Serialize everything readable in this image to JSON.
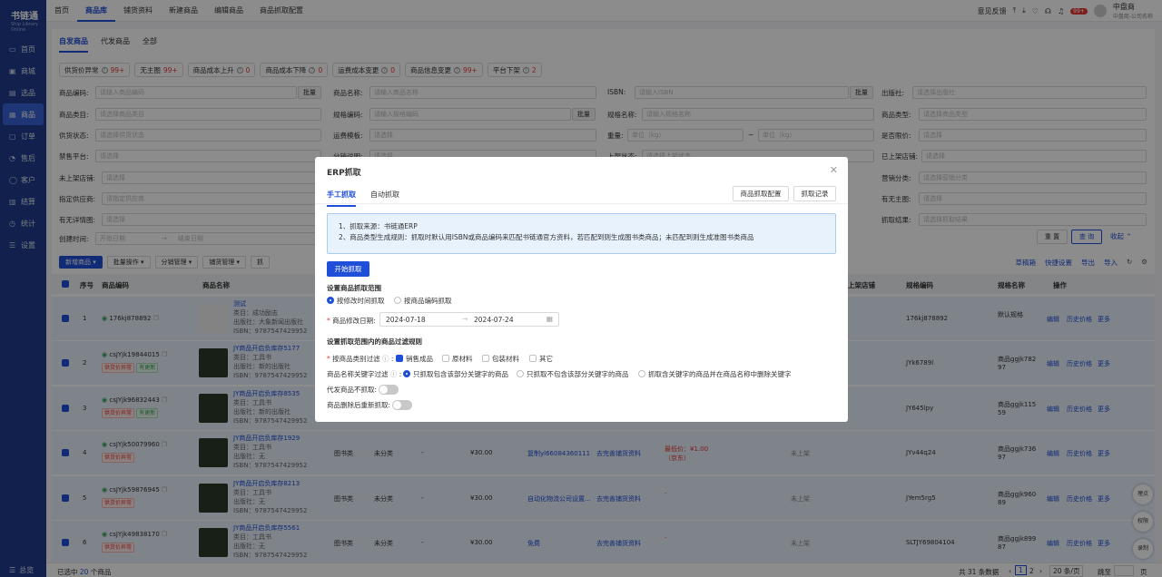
{
  "app": {
    "name": "书链通",
    "subtitle": "Ship Library Online"
  },
  "sidebar": {
    "items": [
      {
        "label": "首页",
        "icon": "monitor-icon"
      },
      {
        "label": "商城",
        "icon": "shop-icon"
      },
      {
        "label": "选品",
        "icon": "select-icon"
      },
      {
        "label": "商品",
        "icon": "product-icon"
      },
      {
        "label": "订单",
        "icon": "order-icon"
      },
      {
        "label": "售后",
        "icon": "aftersale-icon"
      },
      {
        "label": "客户",
        "icon": "customer-icon"
      },
      {
        "label": "结算",
        "icon": "settle-icon"
      },
      {
        "label": "统计",
        "icon": "stats-icon"
      },
      {
        "label": "设置",
        "icon": "settings-icon"
      }
    ],
    "bottom": "总览"
  },
  "topnav": {
    "tabs": [
      "首页",
      "商品库",
      "铺货资料",
      "新建商品",
      "编辑商品",
      "商品抓取配置"
    ],
    "feedback": "意见反馈",
    "badge": "99+",
    "user_name": "中盘商",
    "user_role": "中盘商-公司名称"
  },
  "subtabs": [
    "自发商品",
    "代发商品",
    "全部"
  ],
  "filter_chips": [
    {
      "label": "供货价异常",
      "count": "99+"
    },
    {
      "label": "无主图",
      "count": "99+"
    },
    {
      "label": "商品成本上升",
      "count": "0"
    },
    {
      "label": "商品成本下降",
      "count": "0"
    },
    {
      "label": "运费成本变更",
      "count": "0"
    },
    {
      "label": "商品信息变更",
      "count": "99+"
    },
    {
      "label": "平台下架",
      "count": "2"
    }
  ],
  "form": {
    "product_code": "商品编码:",
    "product_code_ph": "请输入商品编码",
    "batch": "批量",
    "product_name": "商品名称:",
    "product_name_ph": "请输入商品名称",
    "isbn": "ISBN:",
    "isbn_ph": "请输入ISBN",
    "publisher": "出版社:",
    "publisher_ph": "请选择出版社",
    "category": "商品类目:",
    "category_ph": "请选择商品类目",
    "spec_code": "规格编码:",
    "spec_code_ph": "请输入规格编码",
    "spec_name": "规格名称:",
    "spec_name_ph": "请输入规格名称",
    "product_type": "商品类型:",
    "product_type_ph": "请选择商品类型",
    "supply_status": "供货状态:",
    "supply_status_ph": "请选择供货状态",
    "freight_tpl": "运费模板:",
    "freight_tpl_ph": "请选择",
    "weight": "重量:",
    "weight_ph": "单位（kg）",
    "weight_to": "~",
    "limit_price": "是否限价:",
    "limit_price_ph": "请选择",
    "banned_platform": "禁售平台:",
    "banned_platform_ph": "请选择",
    "dist_note": "分销说明:",
    "dist_note_ph": "请选择",
    "shelf_status": "上架状态:",
    "shelf_status_ph": "请选择上架状态",
    "listed_store": "已上架店铺:",
    "listed_store_ph": "请选择",
    "unlisted_store": "未上架店铺:",
    "unlisted_store_ph": "请选择",
    "marketing": "营销分类:",
    "marketing_ph": "请选择营销分类",
    "supplier": "指定供应商:",
    "supplier_ph": "请指定供应商",
    "no_main_img": "有无主图:",
    "no_main_img_ph": "请选择",
    "detail_img": "有无详情图:",
    "detail_img_ph": "请选择",
    "grab_result": "抓取结果:",
    "grab_result_ph": "请选择抓取结果",
    "created": "创建时间:",
    "start_date_ph": "开始日期",
    "end_date_ph": "结束日期",
    "reset": "重 置",
    "search": "查 询",
    "collapse": "收起"
  },
  "toolbar": {
    "new_product": "新增商品",
    "batch_ops": "批量操作",
    "dist_mgmt": "分销管理",
    "stock_mgmt": "铺货管理",
    "more": "抓",
    "draft": "草稿箱",
    "quick_settings": "快捷设置",
    "export": "导出",
    "import": "导入"
  },
  "table": {
    "headers": [
      "序号",
      "商品编码",
      "商品名称",
      "上架店铺",
      "规格编码",
      "规格名称",
      "操作"
    ],
    "rows": [
      {
        "idx": "1",
        "code": "176kj878892",
        "tags": [],
        "name": "测试",
        "line1": "类目：成功励志",
        "line2": "出版社：大象新闻出版社",
        "line3": "ISBN：9787547429952",
        "type": "",
        "cat": "",
        "dash": "",
        "price": "",
        "source": "",
        "dist": "",
        "extra": "",
        "store": "",
        "spec_code": "176kj878892",
        "spec_name": "默认规格",
        "ops": [
          "编辑",
          "历史价格",
          "更多"
        ]
      },
      {
        "idx": "2",
        "code": "csJYjk19844015",
        "tags": [
          "供货价异常",
          "有更新"
        ],
        "name": "JY商品开启负库存5177",
        "line1": "类目：工具书",
        "line2": "出版社：新的出版社",
        "line3": "ISBN：9787547429952",
        "type": "",
        "cat": "",
        "dash": "",
        "price": "",
        "source": "",
        "dist": "",
        "extra": "",
        "store": "",
        "spec_code": "JYk6789l",
        "spec_name": "商品ggjk78297",
        "ops": [
          "编辑",
          "历史价格",
          "更多"
        ]
      },
      {
        "idx": "3",
        "code": "csJYjk96832443",
        "tags": [
          "供货价异常",
          "有更新"
        ],
        "name": "JY商品开启负库存8535",
        "line1": "类目：工具书",
        "line2": "出版社：新的出版社",
        "line3": "ISBN：9787547429952",
        "type": "",
        "cat": "",
        "dash": "",
        "price": "",
        "source": "",
        "dist": "",
        "extra": "",
        "store": "",
        "spec_code": "JY645lpy",
        "spec_name": "商品ggjk11559",
        "ops": [
          "编辑",
          "历史价格",
          "更多"
        ]
      },
      {
        "idx": "4",
        "code": "csJYjk50079960",
        "tags": [
          "供货价异常"
        ],
        "name": "JY商品开启负库存1929",
        "line1": "类目：工具书",
        "line2": "出版社：无",
        "line3": "ISBN：9787547429952",
        "type": "图书类",
        "cat": "未分类",
        "dash": "-",
        "price": "¥30.00",
        "source": "复制yl66084360111",
        "dist": "去完善铺货资料",
        "extra": "最低价：¥1.00（京东）",
        "store": "未上架",
        "spec_code": "JYv44q24",
        "spec_name": "商品ggjk73697",
        "ops": [
          "编辑",
          "历史价格",
          "更多"
        ]
      },
      {
        "idx": "5",
        "code": "csJYjk59876945",
        "tags": [
          "供货价异常"
        ],
        "name": "JY商品开启负库存8213",
        "line1": "类目：工具书",
        "line2": "出版社：无",
        "line3": "ISBN：9787547429952",
        "type": "图书类",
        "cat": "未分类",
        "dash": "-",
        "price": "¥30.00",
        "source": "自动化物流公司设置...",
        "dist": "去完善铺货资料",
        "extra": "-",
        "store": "未上架",
        "spec_code": "JYem5rg5",
        "spec_name": "商品ggjk96089",
        "ops": [
          "编辑",
          "历史价格",
          "更多"
        ]
      },
      {
        "idx": "6",
        "code": "csJYjk49838170",
        "tags": [
          "供货价异常"
        ],
        "name": "JY商品开启负库存5561",
        "line1": "类目：工具书",
        "line2": "出版社：无",
        "line3": "ISBN：9787547429952",
        "type": "图书类",
        "cat": "未分类",
        "dash": "-",
        "price": "¥30.00",
        "source": "免费",
        "dist": "去完善铺货资料",
        "extra": "-",
        "store": "未上架",
        "spec_code": "SLTJY69804104",
        "spec_name": "商品ggjk89987",
        "ops": [
          "编辑",
          "历史价格",
          "更多"
        ]
      }
    ]
  },
  "footer": {
    "selected_prefix": "已选中",
    "selected_count": "20",
    "selected_suffix": "个商品",
    "total": "共 31 条数据",
    "page1": "1",
    "page2": "2",
    "page_size": "20 条/页",
    "goto": "跳至",
    "page_unit": "页"
  },
  "floating": [
    "埋点",
    "权限",
    "录制"
  ],
  "modal": {
    "title": "ERP抓取",
    "tabs": [
      "手工抓取",
      "自动抓取"
    ],
    "config_btn": "商品抓取配置",
    "log_btn": "抓取记录",
    "info1": "1、抓取来源：书链通ERP",
    "info2": "2、商品类型生成规则：抓取时默认用ISBN或商品编码来匹配书链通官方资料，若匹配到则生成图书类商品；未匹配到则生成准图书类商品",
    "start_btn": "开始抓取",
    "range_title": "设置商品抓取范围",
    "range_opt1": "按修改时间抓取",
    "range_opt2": "按商品编码抓取",
    "date_label": "商品修改日期:",
    "date_start": "2024-07-18",
    "date_end": "2024-07-24",
    "filter_title": "设置抓取范围内的商品过滤规则",
    "cat_filter_label": "按商品类别过滤",
    "cat_opts": [
      "销售成品",
      "原材料",
      "包装材料",
      "其它"
    ],
    "kw_label": "商品名称关键字过滤",
    "kw_opts": [
      "只抓取包含该部分关键字的商品",
      "只抓取不包含该部分关键字的商品",
      "抓取含关键字的商品并在商品名称中删除关键字"
    ],
    "dropship_label": "代发商品不抓取:",
    "regrab_label": "商品删除后重新抓取:"
  }
}
